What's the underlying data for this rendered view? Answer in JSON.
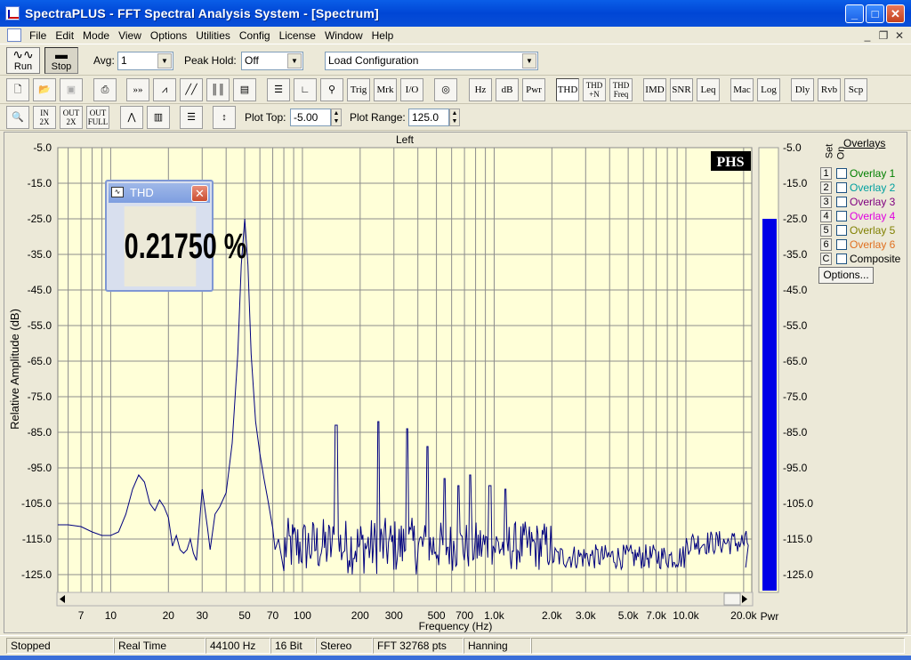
{
  "window": {
    "title": "SpectraPLUS - FFT Spectral Analysis System - [Spectrum]",
    "buttons": [
      "_",
      "□",
      "✕"
    ]
  },
  "menu": [
    "File",
    "Edit",
    "Mode",
    "View",
    "Options",
    "Utilities",
    "Config",
    "License",
    "Window",
    "Help"
  ],
  "mdi_controls": [
    "_",
    "❐",
    "✕"
  ],
  "toolbar1": {
    "run_label": "Run",
    "stop_label": "Stop",
    "avg_label": "Avg:",
    "avg_value": "1",
    "peak_hold_label": "Peak Hold:",
    "peak_hold_value": "Off",
    "config_value": "Load Configuration"
  },
  "toolbar2": {
    "trig": "Trig",
    "mrk": "Mrk",
    "io": "I/O",
    "hz": "Hz",
    "db": "dB",
    "pwr": "Pwr",
    "thd": "THD",
    "thdn_1": "THD",
    "thdn_2": "+N",
    "thdf_1": "THD",
    "thdf_2": "Freq",
    "imd": "IMD",
    "snr": "SNR",
    "leq": "Leq",
    "mac": "Mac",
    "log": "Log",
    "dly": "Dly",
    "rvb": "Rvb",
    "scp": "Scp"
  },
  "toolbar3": {
    "zoom_in": "IN",
    "zoom_2x": "2X",
    "zoom_out": "OUT",
    "zoom_full": "FULL",
    "plot_top_label": "Plot Top:",
    "plot_top_value": "-5.00",
    "plot_range_label": "Plot Range:",
    "plot_range_value": "125.0"
  },
  "chart_data": {
    "type": "line",
    "title": "Left",
    "xlabel": "Frequency (Hz)",
    "ylabel": "Relative Amplitude (dB)",
    "x_scale": "log",
    "xlim": [
      5.3,
      22050
    ],
    "ylim": [
      -130,
      -5
    ],
    "yticks": [
      -5,
      -15,
      -25,
      -35,
      -45,
      -55,
      -65,
      -75,
      -85,
      -95,
      -105,
      -115,
      -125
    ],
    "ytick_labels": [
      "-5.0",
      "-15.0",
      "-25.0",
      "-35.0",
      "-45.0",
      "-55.0",
      "-65.0",
      "-75.0",
      "-85.0",
      "-95.0",
      "-105.0",
      "-115.0",
      "-125.0"
    ],
    "right_ytick_labels": [
      "-5.0",
      "-15.0",
      "-25.0",
      "-35.0",
      "-45.0",
      "-55.0",
      "-65.0",
      "-75.0",
      "-85.0",
      "-95.0",
      "-105.0",
      "-115.0",
      "-125.0"
    ],
    "xticks": [
      7,
      10,
      20,
      30,
      50,
      70,
      100,
      200,
      300,
      500,
      700,
      1000,
      2000,
      3000,
      5000,
      7000,
      10000,
      20000
    ],
    "xtick_labels": [
      "7",
      "10",
      "20",
      "30",
      "50",
      "70",
      "100",
      "200",
      "300",
      "500",
      "700",
      "1.0k",
      "2.0k",
      "3.0k",
      "5.0k",
      "7.0k",
      "10.0k",
      "20.0k"
    ],
    "grid": true,
    "background": "#ffffd8",
    "line_color": "#00007f",
    "fundamental_hz": 50,
    "fundamental_db": -25,
    "harmonics": [
      {
        "x": 150,
        "y": -83
      },
      {
        "x": 250,
        "y": -82
      },
      {
        "x": 350,
        "y": -84
      },
      {
        "x": 450,
        "y": -89
      },
      {
        "x": 550,
        "y": -98
      },
      {
        "x": 650,
        "y": -100
      },
      {
        "x": 750,
        "y": -97
      },
      {
        "x": 950,
        "y": -100
      },
      {
        "x": 1150,
        "y": -101
      }
    ],
    "low_freq_points": [
      [
        5.3,
        -111
      ],
      [
        6,
        -111
      ],
      [
        7,
        -111.5
      ],
      [
        8,
        -113
      ],
      [
        9,
        -114
      ],
      [
        10,
        -114
      ],
      [
        11,
        -113
      ],
      [
        12,
        -108
      ],
      [
        13,
        -101
      ],
      [
        14,
        -97
      ],
      [
        15,
        -99
      ],
      [
        16,
        -105
      ],
      [
        17,
        -107
      ],
      [
        18,
        -104
      ],
      [
        19,
        -106
      ],
      [
        20,
        -109
      ],
      [
        21,
        -117
      ],
      [
        22,
        -114
      ],
      [
        23,
        -118
      ],
      [
        24,
        -119
      ],
      [
        25,
        -118
      ],
      [
        26,
        -115
      ],
      [
        27,
        -119
      ],
      [
        28,
        -121
      ],
      [
        30,
        -101
      ],
      [
        32,
        -112
      ],
      [
        33,
        -118
      ],
      [
        35,
        -108
      ],
      [
        37,
        -106
      ],
      [
        40,
        -102
      ],
      [
        43,
        -88
      ],
      [
        46,
        -63
      ],
      [
        48,
        -38
      ],
      [
        50,
        -25
      ],
      [
        52,
        -38
      ],
      [
        54,
        -63
      ],
      [
        57,
        -82
      ],
      [
        60,
        -91
      ],
      [
        63,
        -98
      ],
      [
        66,
        -104
      ],
      [
        70,
        -112
      ],
      [
        72,
        -118
      ],
      [
        75,
        -115
      ],
      [
        80,
        -124
      ]
    ],
    "noise_floor_db": -117,
    "power_bar": {
      "label": "Pwr",
      "level_db": -25,
      "color": "#0000e6"
    },
    "logo": "PHS"
  },
  "thd_window": {
    "title": "THD",
    "value": "0.21750 %"
  },
  "overlays": {
    "heading": "Overlays",
    "set_label": "Set",
    "on_label": "On",
    "items": [
      {
        "num": "1",
        "name": "Overlay 1",
        "color": "#008000"
      },
      {
        "num": "2",
        "name": "Overlay 2",
        "color": "#00a0a0"
      },
      {
        "num": "3",
        "name": "Overlay 3",
        "color": "#800080"
      },
      {
        "num": "4",
        "name": "Overlay 4",
        "color": "#e000e0"
      },
      {
        "num": "5",
        "name": "Overlay 5",
        "color": "#808000"
      },
      {
        "num": "6",
        "name": "Overlay 6",
        "color": "#e07020"
      },
      {
        "num": "C",
        "name": "Composite",
        "color": "#000000"
      }
    ],
    "options_label": "Options..."
  },
  "status": [
    "Stopped",
    "Real Time",
    "44100 Hz",
    "16 Bit",
    "Stereo",
    "FFT 32768 pts",
    "Hanning",
    ""
  ]
}
